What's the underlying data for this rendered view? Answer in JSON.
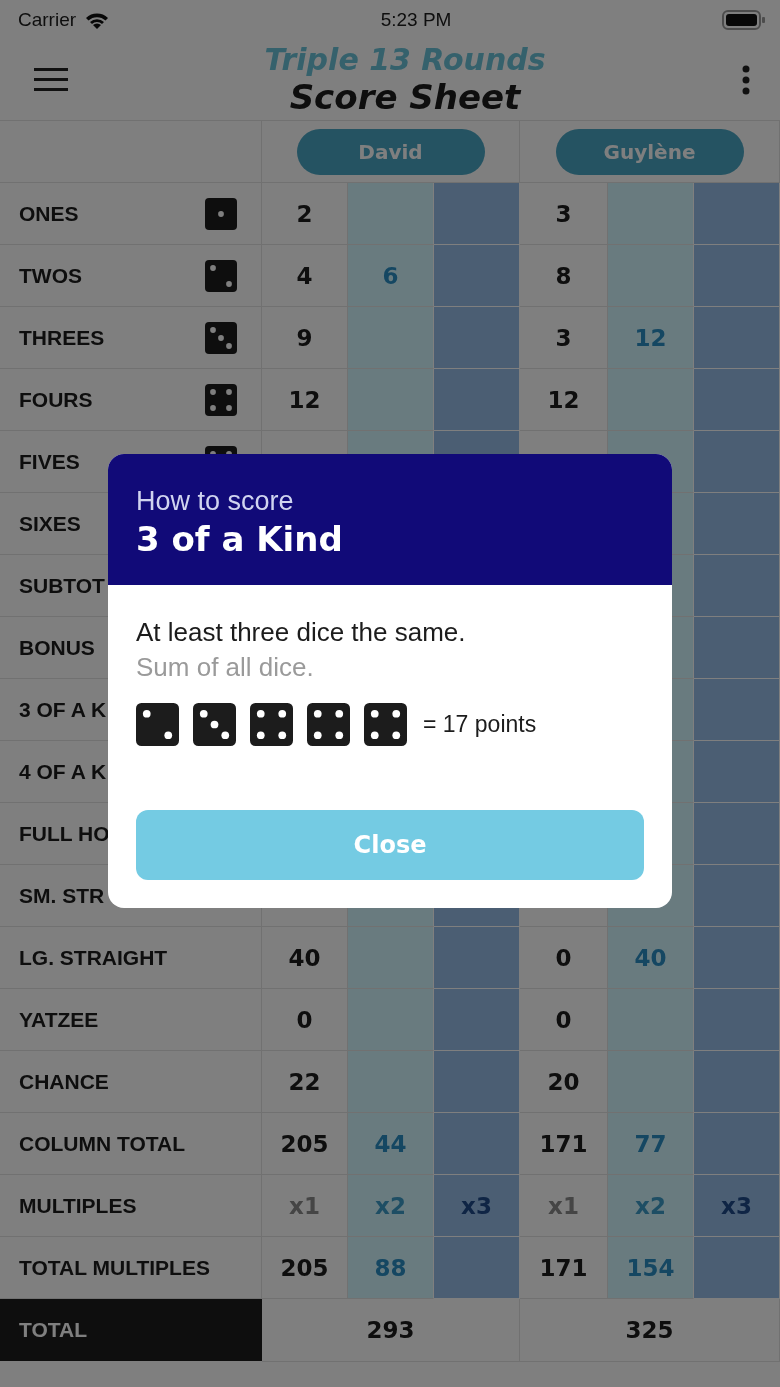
{
  "status_bar": {
    "carrier": "Carrier",
    "time": "5:23 PM"
  },
  "header": {
    "app_title": "Triple 13 Rounds",
    "title": "Score Sheet"
  },
  "players": [
    "David",
    "Guylène"
  ],
  "rows": [
    {
      "label": "ONES",
      "scores": [
        [
          "2"
        ],
        [
          "3"
        ]
      ]
    },
    {
      "label": "TWOS",
      "scores": [
        [
          "4",
          "6"
        ],
        [
          "8"
        ]
      ]
    },
    {
      "label": "THREES",
      "scores": [
        [
          "9"
        ],
        [
          "3",
          "12"
        ]
      ]
    },
    {
      "label": "FOURS",
      "scores": [
        [
          "12"
        ],
        [
          "12"
        ]
      ]
    },
    {
      "label": "FIVES"
    },
    {
      "label": "SIXES"
    },
    {
      "label": "SUBTOT"
    },
    {
      "label": "BONUS"
    },
    {
      "label": "3 OF A K"
    },
    {
      "label": "4 OF A K"
    },
    {
      "label": "FULL HO"
    },
    {
      "label": "SM. STR"
    },
    {
      "label": "LG. STRAIGHT",
      "scores": [
        [
          "40"
        ],
        [
          "0",
          "40"
        ]
      ]
    },
    {
      "label": "YATZEE",
      "scores": [
        [
          "0"
        ],
        [
          "0"
        ]
      ]
    },
    {
      "label": "CHANCE",
      "scores": [
        [
          "22"
        ],
        [
          "20"
        ]
      ]
    },
    {
      "label": "COLUMN TOTAL",
      "scores": [
        [
          "205",
          "44"
        ],
        [
          "171",
          "77"
        ]
      ]
    },
    {
      "label": "MULTIPLES",
      "kind": "multiplier",
      "scores": [
        [
          "x1",
          "x2",
          "x3"
        ],
        [
          "x1",
          "x2",
          "x3"
        ]
      ]
    },
    {
      "label": "TOTAL MULTIPLES",
      "scores": [
        [
          "205",
          "88"
        ],
        [
          "171",
          "154"
        ]
      ]
    }
  ],
  "total": {
    "label": "TOTAL",
    "values": [
      "293",
      "325"
    ]
  },
  "dialog": {
    "overline": "How to score",
    "title": "3 of a Kind",
    "description": "At least three dice the same.",
    "note": "Sum of all dice.",
    "result": "= 17 points",
    "button": "Close"
  }
}
